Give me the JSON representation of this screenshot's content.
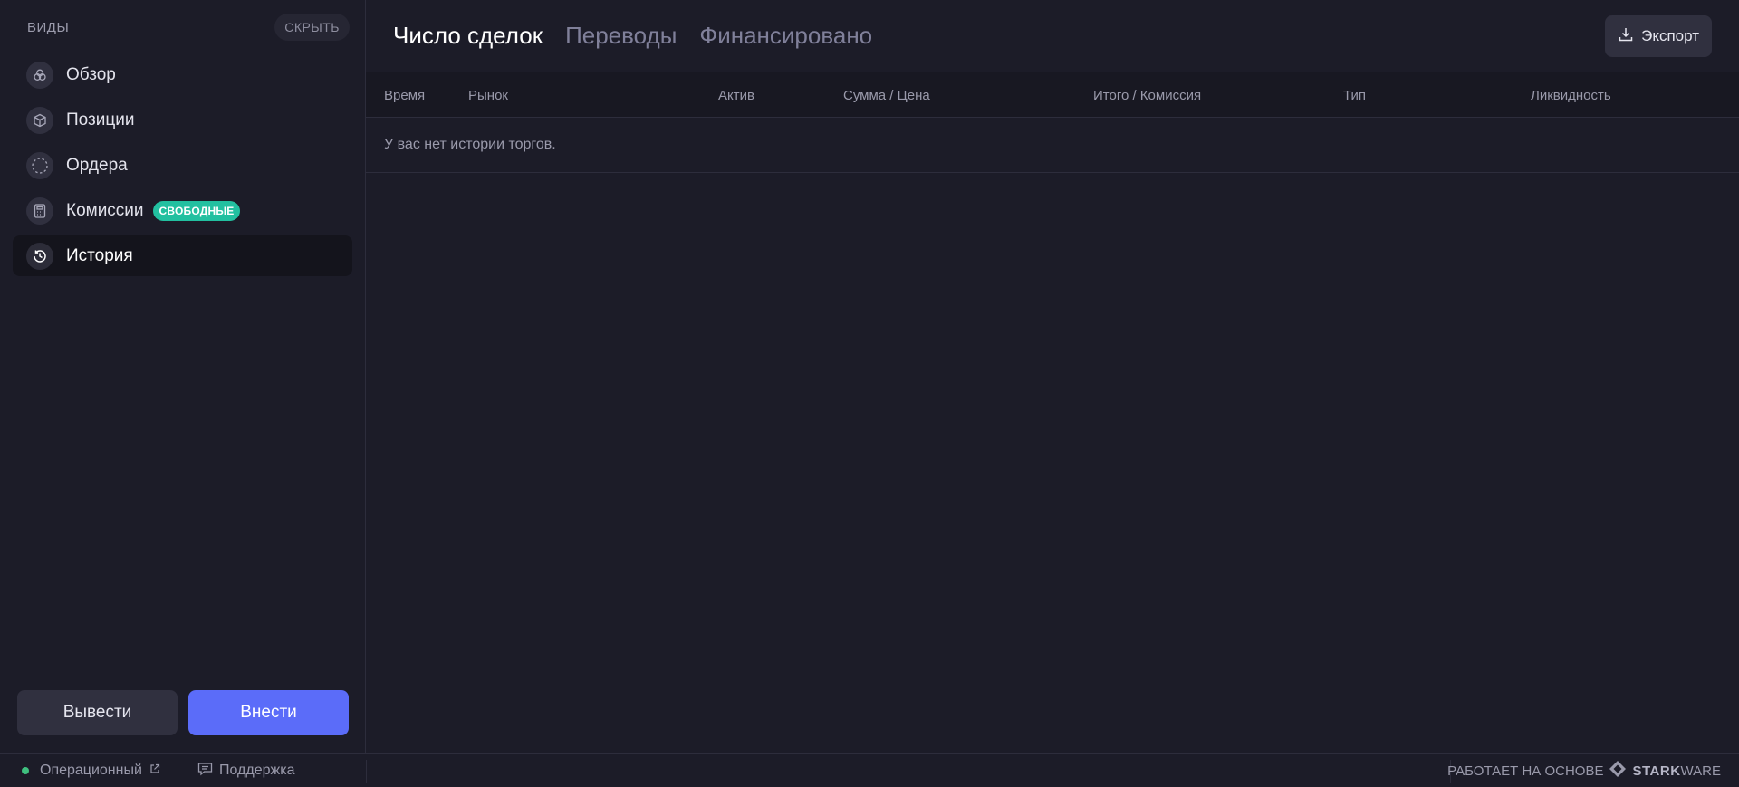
{
  "sidebar": {
    "title": "ВИДЫ",
    "hide_label": "СКРЫТЬ",
    "items": [
      {
        "label": "Обзор",
        "icon": "overview-icon"
      },
      {
        "label": "Позиции",
        "icon": "cube-icon"
      },
      {
        "label": "Ордера",
        "icon": "dashed-circle-icon"
      },
      {
        "label": "Комиссии",
        "icon": "calculator-icon",
        "badge": "СВОБОДНЫЕ"
      },
      {
        "label": "История",
        "icon": "history-icon",
        "active": true
      }
    ],
    "withdraw_label": "Вывести",
    "deposit_label": "Внести"
  },
  "main": {
    "tabs": [
      {
        "label": "Число сделок",
        "active": true
      },
      {
        "label": "Переводы"
      },
      {
        "label": "Финансировано"
      }
    ],
    "export_label": "Экспорт",
    "columns": [
      "Время",
      "Рынок",
      "Актив",
      "Сумма / Цена",
      "Итого / Комиссия",
      "Тип",
      "Ликвидность"
    ],
    "empty_message": "У вас нет истории торгов."
  },
  "footer": {
    "status": "Операционный",
    "support": "Поддержка",
    "powered_by": "РАБОТАЕТ НА ОСНОВЕ",
    "brand_bold": "STARK",
    "brand_rest": "WARE"
  },
  "colors": {
    "background": "#1c1c28",
    "accent": "#5b6cf9",
    "badge": "#22c0a0",
    "status": "#3fc07f"
  }
}
